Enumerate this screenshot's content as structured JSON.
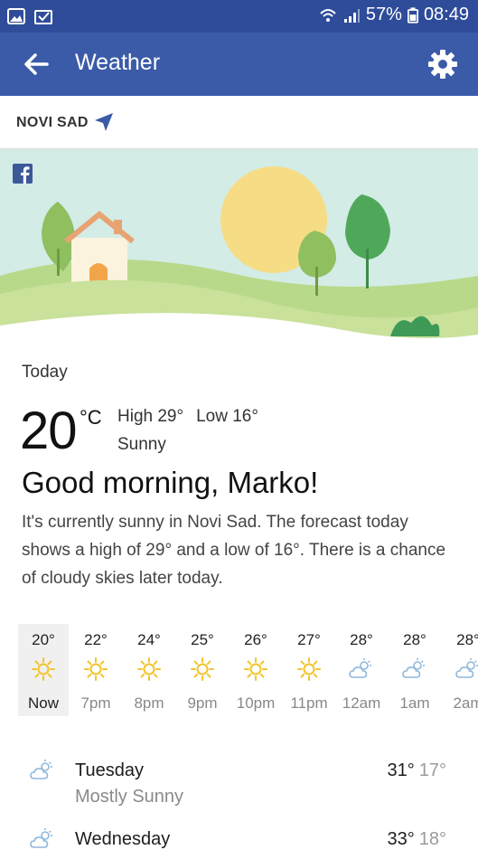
{
  "status_bar": {
    "battery": "57%",
    "time": "08:49",
    "left_icons": [
      "image-icon",
      "mail-check-icon"
    ],
    "right_icons": [
      "wifi-icon",
      "signal-icon",
      "battery-icon"
    ]
  },
  "appbar": {
    "title": "Weather",
    "color": "#3b5ba8"
  },
  "location": {
    "name": "NOVI SAD"
  },
  "today": {
    "label": "Today",
    "temp": "20",
    "unit": "°C",
    "high": "High 29°",
    "low": "Low 16°",
    "condition": "Sunny",
    "greeting": "Good morning, Marko!",
    "summary": "It's currently sunny in Novi Sad. The forecast today shows a high of 29° and a low of 16°. There is a chance of cloudy skies later today."
  },
  "hourly": [
    {
      "temp": "20°",
      "label": "Now",
      "icon": "sun-icon"
    },
    {
      "temp": "22°",
      "label": "7pm",
      "icon": "sun-icon"
    },
    {
      "temp": "24°",
      "label": "8pm",
      "icon": "sun-icon"
    },
    {
      "temp": "25°",
      "label": "9pm",
      "icon": "sun-icon"
    },
    {
      "temp": "26°",
      "label": "10pm",
      "icon": "sun-icon"
    },
    {
      "temp": "27°",
      "label": "11pm",
      "icon": "sun-icon"
    },
    {
      "temp": "28°",
      "label": "12am",
      "icon": "cloud-sun-icon"
    },
    {
      "temp": "28°",
      "label": "1am",
      "icon": "cloud-sun-icon"
    },
    {
      "temp": "28°",
      "label": "2am",
      "icon": "cloud-sun-icon"
    }
  ],
  "daily": [
    {
      "day": "Tuesday",
      "condition": "Mostly Sunny",
      "high": "31°",
      "low": "17°",
      "icon": "cloud-sun-icon"
    },
    {
      "day": "Wednesday",
      "condition": "",
      "high": "33°",
      "low": "18°",
      "icon": "cloud-sun-icon"
    }
  ],
  "colors": {
    "sun": "#f3c42b",
    "cloud": "#8fb8dc",
    "sky": "#cfe9e4",
    "hills": "#a9cf72"
  }
}
